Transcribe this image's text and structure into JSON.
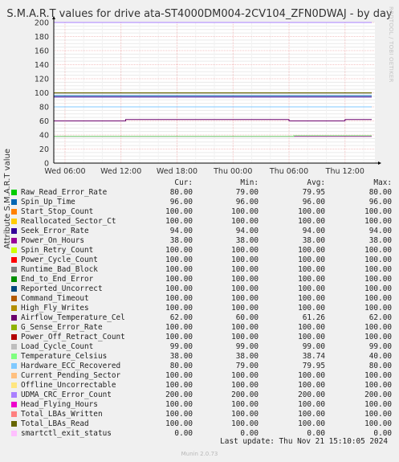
{
  "side_credit": "RRDTOOL / TOBI OETIKER",
  "chart_data": {
    "type": "line",
    "title": "S.M.A.R.T values for drive ata-ST4000DM004-2CV104_ZFN0DWAJ - by day",
    "ylabel": "Attribute S.M.A.R.T value",
    "xlabel": "",
    "ylim": [
      0,
      200
    ],
    "yticks": [
      0,
      20,
      40,
      60,
      80,
      100,
      120,
      140,
      160,
      180,
      200
    ],
    "xticks": [
      "Wed 06:00",
      "Wed 12:00",
      "Wed 18:00",
      "Thu 00:00",
      "Thu 06:00",
      "Thu 12:00"
    ],
    "xlim_hours": [
      -1.2,
      33.2
    ],
    "xtick_hours": [
      0,
      6,
      12,
      18,
      24,
      30
    ],
    "grid": true,
    "legend_placement": "bottom",
    "series": [
      {
        "name": "Raw_Read_Error_Rate",
        "color": "#00cc00",
        "values": [
          80,
          79,
          79.95,
          80
        ]
      },
      {
        "name": "Spin_Up_Time",
        "color": "#0066b3",
        "values": [
          96,
          96,
          96,
          96
        ]
      },
      {
        "name": "Start_Stop_Count",
        "color": "#ff8000",
        "values": [
          100,
          100,
          100,
          100
        ]
      },
      {
        "name": "Reallocated_Sector_Ct",
        "color": "#ffcc00",
        "values": [
          100,
          100,
          100,
          100
        ]
      },
      {
        "name": "Seek_Error_Rate",
        "color": "#330099",
        "values": [
          94,
          94,
          94,
          94
        ]
      },
      {
        "name": "Power_On_Hours",
        "color": "#990099",
        "values": [
          38,
          38,
          38,
          38
        ]
      },
      {
        "name": "Spin_Retry_Count",
        "color": "#ccff00",
        "values": [
          100,
          100,
          100,
          100
        ]
      },
      {
        "name": "Power_Cycle_Count",
        "color": "#ff0000",
        "values": [
          100,
          100,
          100,
          100
        ]
      },
      {
        "name": "Runtime_Bad_Block",
        "color": "#808080",
        "values": [
          100,
          100,
          100,
          100
        ]
      },
      {
        "name": "End_to_End_Error",
        "color": "#008f00",
        "values": [
          100,
          100,
          100,
          100
        ]
      },
      {
        "name": "Reported_Uncorrect",
        "color": "#00487d",
        "values": [
          100,
          100,
          100,
          100
        ]
      },
      {
        "name": "Command_Timeout",
        "color": "#b35a00",
        "values": [
          100,
          100,
          100,
          100
        ]
      },
      {
        "name": "High_Fly_Writes",
        "color": "#b38f00",
        "values": [
          100,
          100,
          100,
          100
        ]
      },
      {
        "name": "Airflow_Temperature_Cel",
        "color": "#6b006b",
        "values": [
          62,
          60,
          61.26,
          62
        ]
      },
      {
        "name": "G_Sense_Error_Rate",
        "color": "#8fb300",
        "values": [
          100,
          100,
          100,
          100
        ]
      },
      {
        "name": "Power_Off_Retract_Count",
        "color": "#b30000",
        "values": [
          100,
          100,
          100,
          100
        ]
      },
      {
        "name": "Load_Cycle_Count",
        "color": "#bebebe",
        "values": [
          99,
          99,
          99,
          99
        ]
      },
      {
        "name": "Temperature_Celsius",
        "color": "#80ff80",
        "values": [
          38,
          38,
          38.74,
          40
        ]
      },
      {
        "name": "Hardware_ECC_Recovered",
        "color": "#80c9ff",
        "values": [
          80,
          79,
          79.95,
          80
        ]
      },
      {
        "name": "Current_Pending_Sector",
        "color": "#ffc080",
        "values": [
          100,
          100,
          100,
          100
        ]
      },
      {
        "name": "Offline_Uncorrectable",
        "color": "#ffe680",
        "values": [
          100,
          100,
          100,
          100
        ]
      },
      {
        "name": "UDMA_CRC_Error_Count",
        "color": "#aa80ff",
        "values": [
          200,
          200,
          200,
          200
        ]
      },
      {
        "name": "Head_Flying_Hours",
        "color": "#ee00cc",
        "values": [
          100,
          100,
          100,
          100
        ]
      },
      {
        "name": "Total_LBAs_Written",
        "color": "#ff8080",
        "values": [
          100,
          100,
          100,
          100
        ]
      },
      {
        "name": "Total_LBAs_Read",
        "color": "#666600",
        "values": [
          100,
          100,
          100,
          100
        ]
      },
      {
        "name": "smartctl_exit_status",
        "color": "#ffbfff",
        "values": [
          0,
          0,
          0,
          0
        ]
      }
    ]
  },
  "legend": {
    "headers": {
      "cur": "Cur:",
      "min": "Min:",
      "avg": "Avg:",
      "max": "Max:"
    },
    "rows": [
      {
        "name": "Raw_Read_Error_Rate",
        "cur": "80.00",
        "min": "79.00",
        "avg": "79.95",
        "max": "80.00"
      },
      {
        "name": "Spin_Up_Time",
        "cur": "96.00",
        "min": "96.00",
        "avg": "96.00",
        "max": "96.00"
      },
      {
        "name": "Start_Stop_Count",
        "cur": "100.00",
        "min": "100.00",
        "avg": "100.00",
        "max": "100.00"
      },
      {
        "name": "Reallocated_Sector_Ct",
        "cur": "100.00",
        "min": "100.00",
        "avg": "100.00",
        "max": "100.00"
      },
      {
        "name": "Seek_Error_Rate",
        "cur": "94.00",
        "min": "94.00",
        "avg": "94.00",
        "max": "94.00"
      },
      {
        "name": "Power_On_Hours",
        "cur": "38.00",
        "min": "38.00",
        "avg": "38.00",
        "max": "38.00"
      },
      {
        "name": "Spin_Retry_Count",
        "cur": "100.00",
        "min": "100.00",
        "avg": "100.00",
        "max": "100.00"
      },
      {
        "name": "Power_Cycle_Count",
        "cur": "100.00",
        "min": "100.00",
        "avg": "100.00",
        "max": "100.00"
      },
      {
        "name": "Runtime_Bad_Block",
        "cur": "100.00",
        "min": "100.00",
        "avg": "100.00",
        "max": "100.00"
      },
      {
        "name": "End_to_End_Error",
        "cur": "100.00",
        "min": "100.00",
        "avg": "100.00",
        "max": "100.00"
      },
      {
        "name": "Reported_Uncorrect",
        "cur": "100.00",
        "min": "100.00",
        "avg": "100.00",
        "max": "100.00"
      },
      {
        "name": "Command_Timeout",
        "cur": "100.00",
        "min": "100.00",
        "avg": "100.00",
        "max": "100.00"
      },
      {
        "name": "High_Fly_Writes",
        "cur": "100.00",
        "min": "100.00",
        "avg": "100.00",
        "max": "100.00"
      },
      {
        "name": "Airflow_Temperature_Cel",
        "cur": "62.00",
        "min": "60.00",
        "avg": "61.26",
        "max": "62.00"
      },
      {
        "name": "G_Sense_Error_Rate",
        "cur": "100.00",
        "min": "100.00",
        "avg": "100.00",
        "max": "100.00"
      },
      {
        "name": "Power_Off_Retract_Count",
        "cur": "100.00",
        "min": "100.00",
        "avg": "100.00",
        "max": "100.00"
      },
      {
        "name": "Load_Cycle_Count",
        "cur": "99.00",
        "min": "99.00",
        "avg": "99.00",
        "max": "99.00"
      },
      {
        "name": "Temperature_Celsius",
        "cur": "38.00",
        "min": "38.00",
        "avg": "38.74",
        "max": "40.00"
      },
      {
        "name": "Hardware_ECC_Recovered",
        "cur": "80.00",
        "min": "79.00",
        "avg": "79.95",
        "max": "80.00"
      },
      {
        "name": "Current_Pending_Sector",
        "cur": "100.00",
        "min": "100.00",
        "avg": "100.00",
        "max": "100.00"
      },
      {
        "name": "Offline_Uncorrectable",
        "cur": "100.00",
        "min": "100.00",
        "avg": "100.00",
        "max": "100.00"
      },
      {
        "name": "UDMA_CRC_Error_Count",
        "cur": "200.00",
        "min": "200.00",
        "avg": "200.00",
        "max": "200.00"
      },
      {
        "name": "Head_Flying_Hours",
        "cur": "100.00",
        "min": "100.00",
        "avg": "100.00",
        "max": "100.00"
      },
      {
        "name": "Total_LBAs_Written",
        "cur": "100.00",
        "min": "100.00",
        "avg": "100.00",
        "max": "100.00"
      },
      {
        "name": "Total_LBAs_Read",
        "cur": "100.00",
        "min": "100.00",
        "avg": "100.00",
        "max": "100.00"
      },
      {
        "name": "smartctl_exit_status",
        "cur": "0.00",
        "min": "0.00",
        "avg": "0.00",
        "max": "0.00"
      }
    ]
  },
  "last_update": "Last update: Thu Nov 21 15:10:05 2024",
  "munin_version": "Munin 2.0.73"
}
